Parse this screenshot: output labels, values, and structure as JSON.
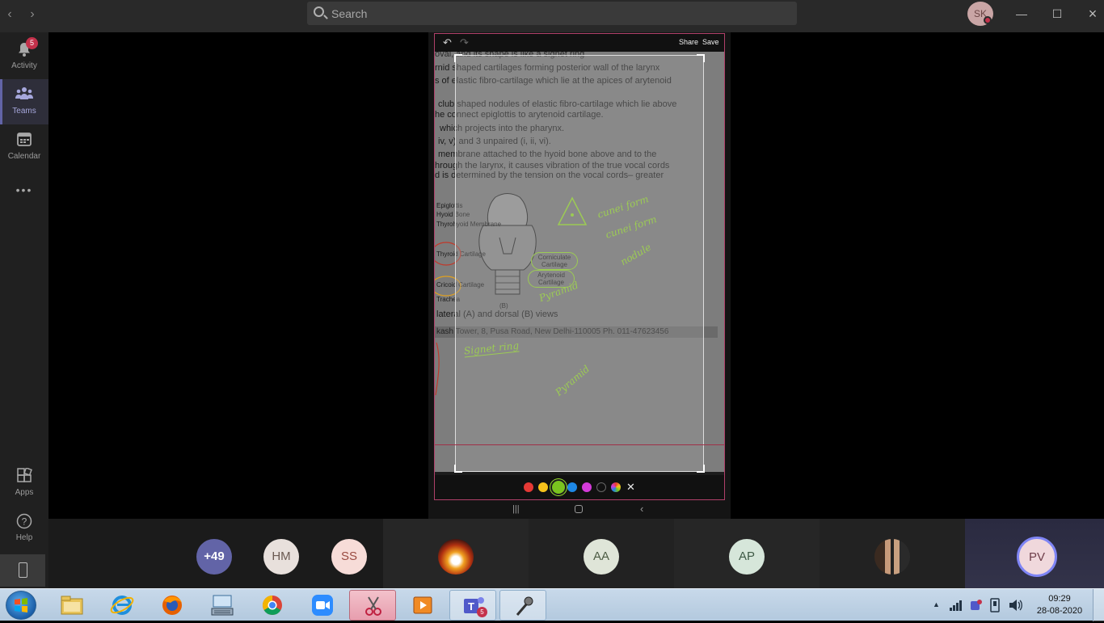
{
  "titlebar": {
    "search_placeholder": "Search",
    "user_initials": "SK",
    "back_icon": "chevron-left-icon",
    "forward_icon": "chevron-right-icon"
  },
  "rail": {
    "items": [
      {
        "label": "Activity",
        "icon": "bell-icon",
        "badge": "5"
      },
      {
        "label": "Teams",
        "icon": "teams-icon"
      },
      {
        "label": "Calendar",
        "icon": "calendar-icon"
      },
      {
        "label": "",
        "icon": "more-icon"
      },
      {
        "label": "Apps",
        "icon": "apps-icon"
      },
      {
        "label": "Help",
        "icon": "help-icon"
      }
    ],
    "active": "Teams"
  },
  "editor": {
    "share_label": "Share",
    "save_label": "Save",
    "doc_lines": [
      "oval, and its shape is like a signet ring",
      "rnid shaped cartilages forming posterior wall of the larynx",
      "s of elastic fibro-cartilage which lie at the apices of arytenoid",
      "club shaped nodules of elastic fibro-cartilage which lie above",
      "he connect epiglottis to arytenoid cartilage.",
      "which projects into the pharynx.",
      "iv, v) and 3 unpaired (i, ii, vi).",
      "membrane attached to the hyoid bone above and to the",
      "hrough the larynx, it causes vibration of the true vocal cords",
      "d is determined by the tension on the vocal cords– greater"
    ],
    "diagram_labels": [
      "Epiglottis",
      "Hyoid Bone",
      "Thyrohyoid Membrane",
      "Thyroid Cartilage",
      "Cricoid Cartilage",
      "Trachea",
      "Corniculate Cartilage",
      "Arytenoid Cartilage",
      "(B)"
    ],
    "caption": "lateral (A) and dorsal (B) views",
    "address": "kash Tower, 8, Pusa Road, New Delhi-110005 Ph. 011-47623456",
    "annotations": [
      "cunei form",
      "cunei form",
      "nodule",
      "Pyramid",
      "Signet ring",
      "Pyramid"
    ],
    "palette": [
      {
        "name": "red",
        "color": "#e53935"
      },
      {
        "name": "yellow",
        "color": "#f6c21b"
      },
      {
        "name": "green",
        "color": "#7ac41f"
      },
      {
        "name": "blue",
        "color": "#1e88e5"
      },
      {
        "name": "magenta",
        "color": "#d43bd9"
      },
      {
        "name": "black",
        "color": "#111111"
      },
      {
        "name": "multicolor",
        "color": "#8e8ee8"
      }
    ],
    "selected_color": "green"
  },
  "participants": {
    "overflow": "+49",
    "people": [
      {
        "initials": "HM",
        "bg": "#e8e0dc",
        "fg": "#6b5a52"
      },
      {
        "initials": "SS",
        "bg": "#f7dcd8",
        "fg": "#9a4a40"
      },
      {
        "initials": "",
        "photo": true
      },
      {
        "initials": "AA",
        "bg": "#dfe5d8",
        "fg": "#4d5c44"
      },
      {
        "initials": "AP",
        "bg": "#d6e6da",
        "fg": "#3f5a46"
      },
      {
        "initials": "",
        "photo": true
      },
      {
        "initials": "PV",
        "bg": "#f0d8dc",
        "fg": "#6e3e4a"
      }
    ]
  },
  "taskbar": {
    "apps": [
      "file-explorer-icon",
      "internet-explorer-icon",
      "firefox-icon",
      "keyboard-icon",
      "chrome-icon",
      "zoom-icon",
      "snipping-tool-icon",
      "media-player-icon",
      "teams-icon",
      "microphone-icon"
    ],
    "teams_badge": "5",
    "time": "09:29",
    "date": "28-08-2020"
  }
}
